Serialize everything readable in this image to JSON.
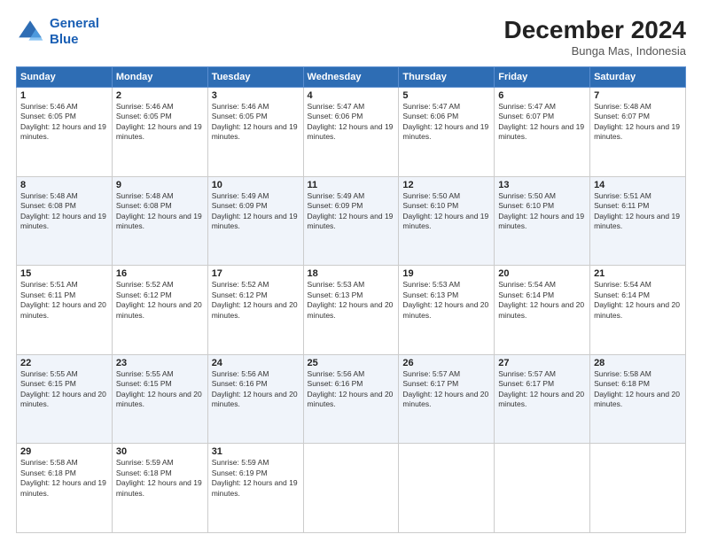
{
  "header": {
    "logo_line1": "General",
    "logo_line2": "Blue",
    "month": "December 2024",
    "location": "Bunga Mas, Indonesia"
  },
  "days_of_week": [
    "Sunday",
    "Monday",
    "Tuesday",
    "Wednesday",
    "Thursday",
    "Friday",
    "Saturday"
  ],
  "weeks": [
    [
      {
        "day": "1",
        "sunrise": "5:46 AM",
        "sunset": "6:05 PM",
        "daylight": "12 hours and 19 minutes."
      },
      {
        "day": "2",
        "sunrise": "5:46 AM",
        "sunset": "6:05 PM",
        "daylight": "12 hours and 19 minutes."
      },
      {
        "day": "3",
        "sunrise": "5:46 AM",
        "sunset": "6:05 PM",
        "daylight": "12 hours and 19 minutes."
      },
      {
        "day": "4",
        "sunrise": "5:47 AM",
        "sunset": "6:06 PM",
        "daylight": "12 hours and 19 minutes."
      },
      {
        "day": "5",
        "sunrise": "5:47 AM",
        "sunset": "6:06 PM",
        "daylight": "12 hours and 19 minutes."
      },
      {
        "day": "6",
        "sunrise": "5:47 AM",
        "sunset": "6:07 PM",
        "daylight": "12 hours and 19 minutes."
      },
      {
        "day": "7",
        "sunrise": "5:48 AM",
        "sunset": "6:07 PM",
        "daylight": "12 hours and 19 minutes."
      }
    ],
    [
      {
        "day": "8",
        "sunrise": "5:48 AM",
        "sunset": "6:08 PM",
        "daylight": "12 hours and 19 minutes."
      },
      {
        "day": "9",
        "sunrise": "5:48 AM",
        "sunset": "6:08 PM",
        "daylight": "12 hours and 19 minutes."
      },
      {
        "day": "10",
        "sunrise": "5:49 AM",
        "sunset": "6:09 PM",
        "daylight": "12 hours and 19 minutes."
      },
      {
        "day": "11",
        "sunrise": "5:49 AM",
        "sunset": "6:09 PM",
        "daylight": "12 hours and 19 minutes."
      },
      {
        "day": "12",
        "sunrise": "5:50 AM",
        "sunset": "6:10 PM",
        "daylight": "12 hours and 19 minutes."
      },
      {
        "day": "13",
        "sunrise": "5:50 AM",
        "sunset": "6:10 PM",
        "daylight": "12 hours and 19 minutes."
      },
      {
        "day": "14",
        "sunrise": "5:51 AM",
        "sunset": "6:11 PM",
        "daylight": "12 hours and 19 minutes."
      }
    ],
    [
      {
        "day": "15",
        "sunrise": "5:51 AM",
        "sunset": "6:11 PM",
        "daylight": "12 hours and 20 minutes."
      },
      {
        "day": "16",
        "sunrise": "5:52 AM",
        "sunset": "6:12 PM",
        "daylight": "12 hours and 20 minutes."
      },
      {
        "day": "17",
        "sunrise": "5:52 AM",
        "sunset": "6:12 PM",
        "daylight": "12 hours and 20 minutes."
      },
      {
        "day": "18",
        "sunrise": "5:53 AM",
        "sunset": "6:13 PM",
        "daylight": "12 hours and 20 minutes."
      },
      {
        "day": "19",
        "sunrise": "5:53 AM",
        "sunset": "6:13 PM",
        "daylight": "12 hours and 20 minutes."
      },
      {
        "day": "20",
        "sunrise": "5:54 AM",
        "sunset": "6:14 PM",
        "daylight": "12 hours and 20 minutes."
      },
      {
        "day": "21",
        "sunrise": "5:54 AM",
        "sunset": "6:14 PM",
        "daylight": "12 hours and 20 minutes."
      }
    ],
    [
      {
        "day": "22",
        "sunrise": "5:55 AM",
        "sunset": "6:15 PM",
        "daylight": "12 hours and 20 minutes."
      },
      {
        "day": "23",
        "sunrise": "5:55 AM",
        "sunset": "6:15 PM",
        "daylight": "12 hours and 20 minutes."
      },
      {
        "day": "24",
        "sunrise": "5:56 AM",
        "sunset": "6:16 PM",
        "daylight": "12 hours and 20 minutes."
      },
      {
        "day": "25",
        "sunrise": "5:56 AM",
        "sunset": "6:16 PM",
        "daylight": "12 hours and 20 minutes."
      },
      {
        "day": "26",
        "sunrise": "5:57 AM",
        "sunset": "6:17 PM",
        "daylight": "12 hours and 20 minutes."
      },
      {
        "day": "27",
        "sunrise": "5:57 AM",
        "sunset": "6:17 PM",
        "daylight": "12 hours and 20 minutes."
      },
      {
        "day": "28",
        "sunrise": "5:58 AM",
        "sunset": "6:18 PM",
        "daylight": "12 hours and 20 minutes."
      }
    ],
    [
      {
        "day": "29",
        "sunrise": "5:58 AM",
        "sunset": "6:18 PM",
        "daylight": "12 hours and 19 minutes."
      },
      {
        "day": "30",
        "sunrise": "5:59 AM",
        "sunset": "6:18 PM",
        "daylight": "12 hours and 19 minutes."
      },
      {
        "day": "31",
        "sunrise": "5:59 AM",
        "sunset": "6:19 PM",
        "daylight": "12 hours and 19 minutes."
      },
      null,
      null,
      null,
      null
    ]
  ],
  "labels": {
    "sunrise": "Sunrise:",
    "sunset": "Sunset:",
    "daylight": "Daylight:"
  }
}
